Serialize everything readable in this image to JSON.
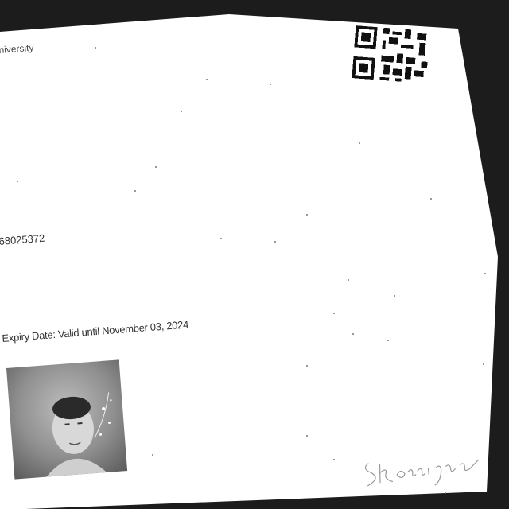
{
  "document": {
    "institution_fragment": "niversity",
    "id_number_fragment": "68025372",
    "expiry_text": "Expiry Date: Valid until November 03, 2024"
  },
  "photo": {
    "subject": "portrait"
  },
  "signature": {
    "text": "S Rossignol"
  },
  "colors": {
    "background": "#1c1c1c",
    "card": "#ffffff",
    "text": "#333333"
  }
}
